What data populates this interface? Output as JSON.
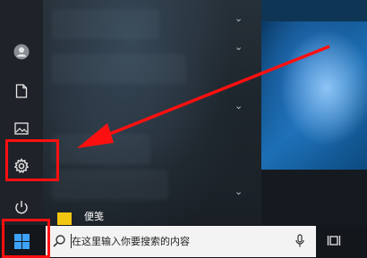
{
  "start_menu": {
    "sticky_notes_label": "便笺"
  },
  "taskbar": {
    "search_placeholder": "在这里输入你要搜索的内容"
  },
  "rail_icons": [
    "user-icon",
    "document-icon",
    "pictures-icon",
    "settings-icon",
    "power-icon"
  ],
  "colors": {
    "annotation_red": "#ff1010",
    "accent_blue": "#1c6fb5",
    "windows_logo": "#3ea2ff",
    "sticky_yellow": "#f2c511"
  }
}
